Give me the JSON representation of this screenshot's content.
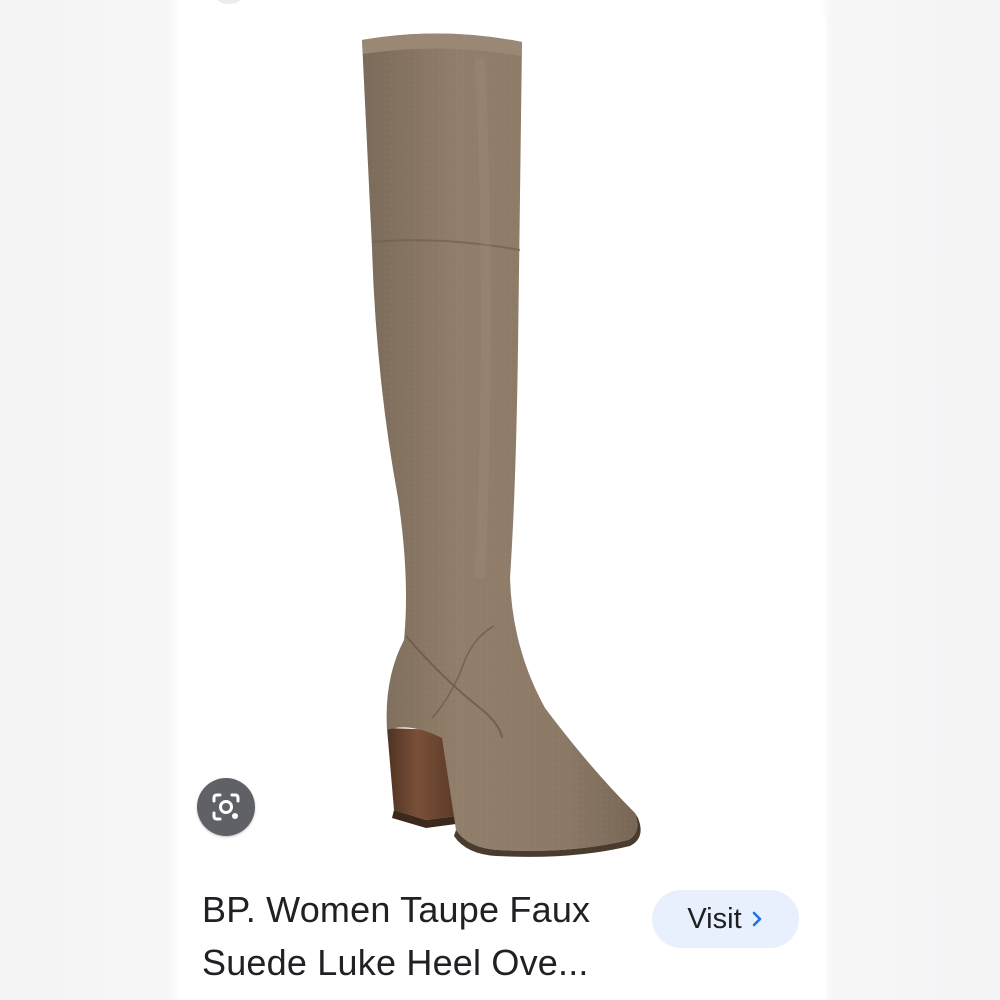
{
  "result": {
    "title": "BP. Women Taupe Faux Suede Luke Heel Ove...",
    "visit_label": "Visit"
  },
  "icons": {
    "lens": "google-lens-icon",
    "chevron": "chevron-right-icon"
  },
  "colors": {
    "boot": "#8c7a66",
    "heel": "#6b4530",
    "visit_button_bg": "#e8f0fe",
    "visit_chevron": "#1a73e8",
    "lens_button_bg": "#5f6166"
  }
}
